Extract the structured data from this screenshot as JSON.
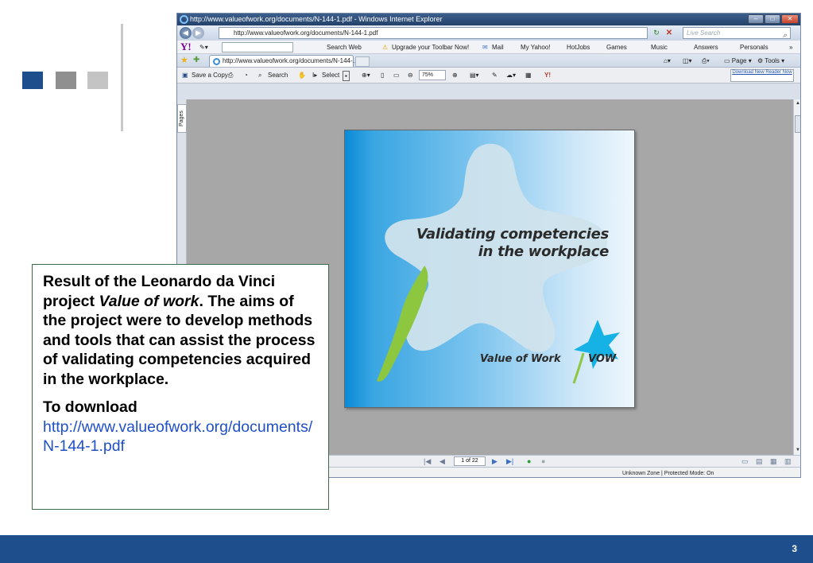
{
  "slide": {
    "page_number": "3",
    "accent_color": "#1f4e8c"
  },
  "browser": {
    "window_title": "http://www.valueofwork.org/documents/N-144-1.pdf - Windows Internet Explorer",
    "address": "http://www.valueofwork.org/documents/N-144-1.pdf",
    "live_search_placeholder": "Live Search",
    "toolbar": {
      "search_web": "Search Web",
      "upgrade": "Upgrade your Toolbar Now!",
      "mail": "Mail",
      "my_yahoo": "My Yahoo!",
      "hotjobs": "HotJobs",
      "games": "Games",
      "music": "Music",
      "answers": "Answers",
      "personals": "Personals"
    },
    "tab_label": "http://www.valueofwork.org/documents/N-144-...",
    "commands": {
      "page": "Page",
      "tools": "Tools"
    },
    "reader": {
      "save_copy": "Save a Copy",
      "search": "Search",
      "select": "Select",
      "zoom": "75%",
      "download_reader": "Download New Reader Now"
    },
    "side_tab": "Pages",
    "page_indicator": "1 of 22",
    "zone_status": "Unknown Zone | Protected Mode: On"
  },
  "pdf": {
    "title_line1": "Validating competencies",
    "title_line2": "in the workplace",
    "brand": "Value of Work",
    "acronym": "VOW"
  },
  "callout": {
    "intro_a": "Result of the Leonardo da Vinci project ",
    "project_name": "Value of work",
    "intro_b": ". The aims of the project were to develop methods and tools that can assist the process of validating competencies acquired in the workplace.",
    "download_heading": "To download",
    "download_url": "http://www.valueofwork.org/documents/N-144-1.pdf"
  }
}
